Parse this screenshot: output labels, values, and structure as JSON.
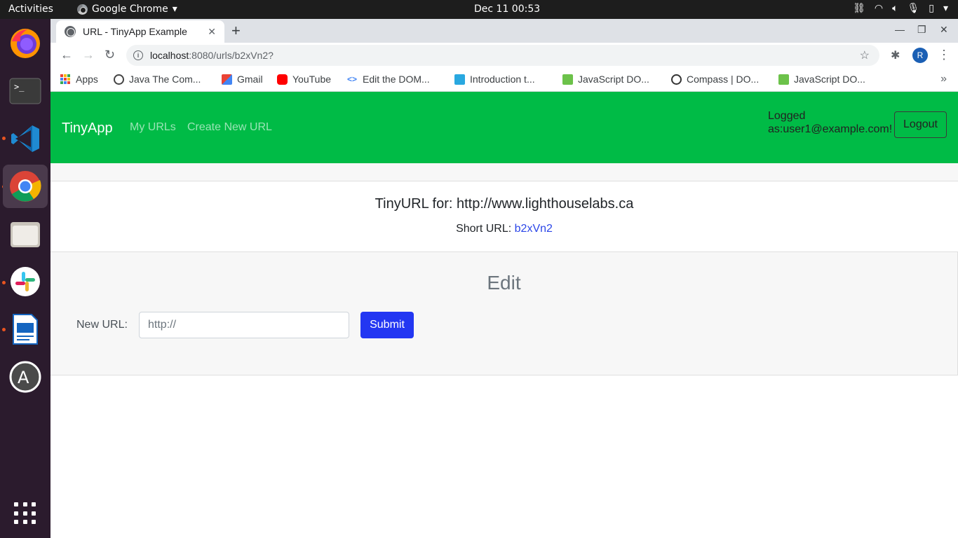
{
  "system_bar": {
    "activities": "Activities",
    "app_name": "Google Chrome",
    "app_menu_arrow": "▾",
    "clock": "Dec 11  00:53",
    "tray_icons": [
      "network-icon",
      "wifi-icon",
      "volume-icon",
      "microphone-icon",
      "battery-icon",
      "power-menu-icon"
    ]
  },
  "dock": {
    "apps": [
      "firefox",
      "terminal",
      "vscode",
      "chrome",
      "files",
      "slack",
      "libreoffice-impress",
      "software-updater"
    ],
    "active": "chrome"
  },
  "browser": {
    "tab_title": "URL - TinyApp Example",
    "url_host": "localhost",
    "url_path": ":8080/urls/b2xVn2?",
    "profile_initial": "R",
    "bookmarks": [
      {
        "label": "Apps"
      },
      {
        "label": "Java The Com..."
      },
      {
        "label": "Gmail"
      },
      {
        "label": "YouTube"
      },
      {
        "label": "Edit the DOM..."
      },
      {
        "label": "Introduction t..."
      },
      {
        "label": "JavaScript DO..."
      },
      {
        "label": "Compass | DO..."
      },
      {
        "label": "JavaScript DO..."
      }
    ],
    "bookmark_overflow": "»"
  },
  "page": {
    "brand": "TinyApp",
    "nav_links": [
      "My URLs",
      "Create New URL"
    ],
    "logged_in_label": "Logged as:user1@example.com!",
    "logout_label": "Logout",
    "card_title": "TinyURL for: http://www.lighthouselabs.ca",
    "short_url_label": "Short URL: ",
    "short_url_value": "b2xVn2",
    "edit_heading": "Edit",
    "new_url_label": "New URL:",
    "new_url_placeholder": "http://",
    "submit_label": "Submit"
  },
  "colors": {
    "navbar": "#00bb46",
    "submit_button": "#2337f2",
    "link": "#2b46e8"
  }
}
